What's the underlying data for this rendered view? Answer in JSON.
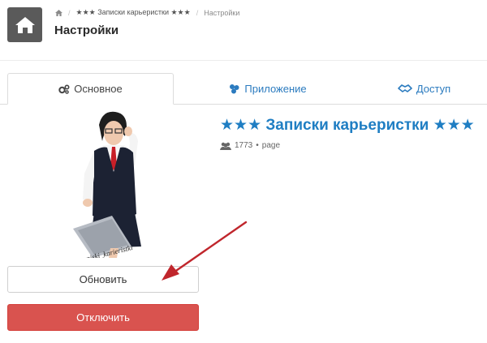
{
  "header": {
    "title": "Настройки",
    "breadcrumb": {
      "group": "★★★ Записки карьеристки ★★★",
      "current": "Настройки"
    }
  },
  "tabs": [
    {
      "label": "Основное",
      "icon": "gears-icon"
    },
    {
      "label": "Приложение",
      "icon": "puzzle-icon"
    },
    {
      "label": "Доступ",
      "icon": "handshake-icon"
    }
  ],
  "group": {
    "name": "★★★ Записки карьеристки ★★★",
    "members": "1773",
    "type": "page",
    "avatar_watermark": "zapiski_karieristki"
  },
  "buttons": {
    "update": "Обновить",
    "disable": "Отключить"
  },
  "colors": {
    "accent": "#1f7ec3",
    "danger": "#d9534f",
    "arrow": "#c0262c",
    "home": "#5a5a5a"
  }
}
